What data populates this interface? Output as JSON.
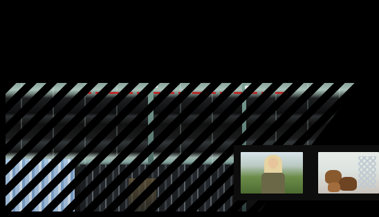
{
  "screen": {
    "background_color": "#000000",
    "accent_color_red": "#c0201e"
  },
  "video_frame": {
    "state": "glitched",
    "main_scene": "building-facade",
    "overlay": "diagonal-black-bars"
  },
  "thumbnails": [
    {
      "subject": "woman-outdoors"
    },
    {
      "subject": "puppies"
    }
  ]
}
